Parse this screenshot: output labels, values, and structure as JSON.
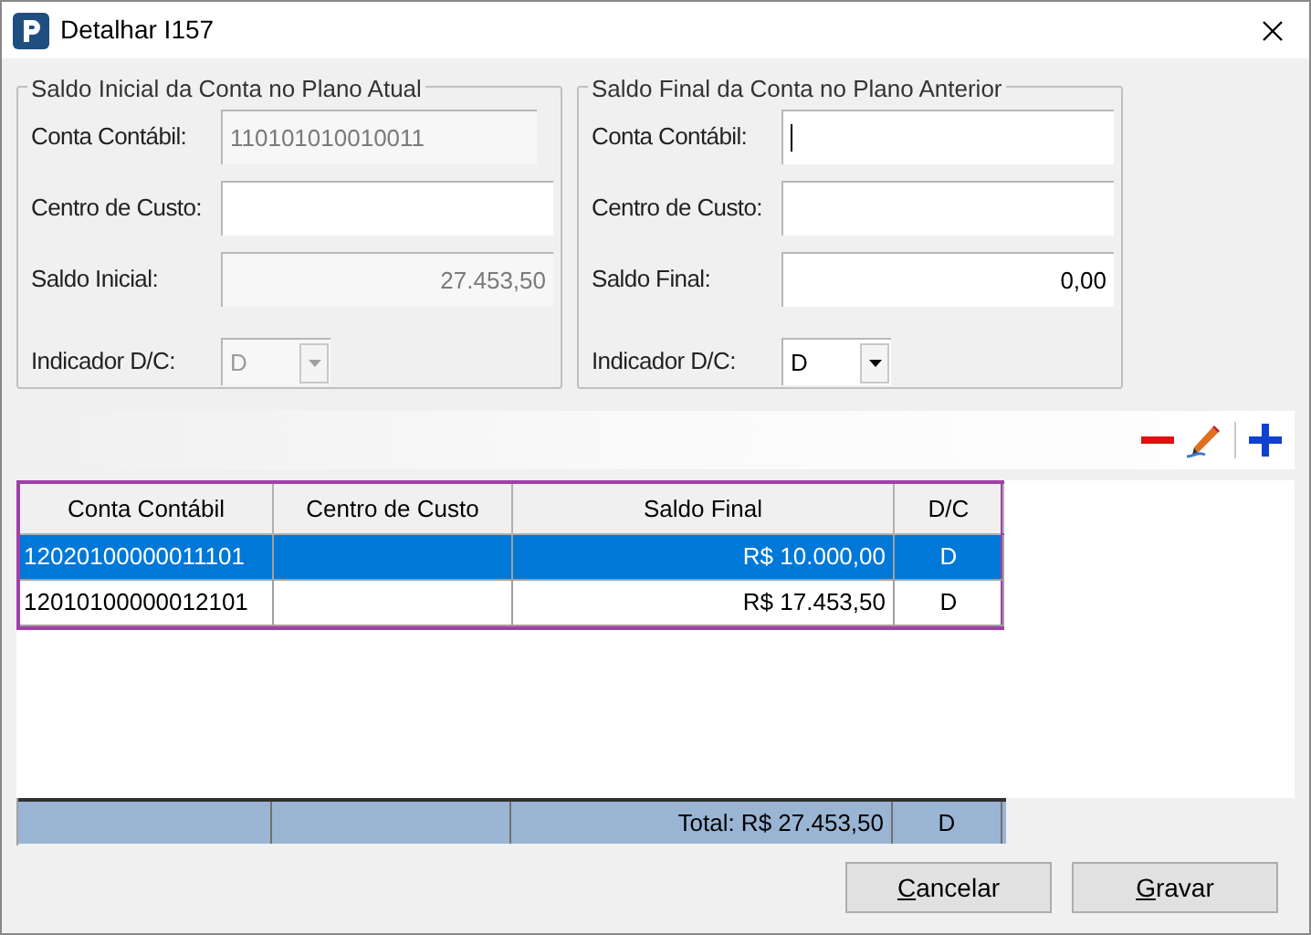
{
  "window": {
    "title": "Detalhar I157"
  },
  "groups": [
    {
      "title": "Saldo Inicial da Conta no Plano Atual",
      "fields": [
        {
          "kind": "text",
          "label": "Conta Contábil:",
          "value": "110101010010011",
          "readonly": true
        },
        {
          "kind": "text",
          "label": "Centro de Custo:"
        },
        {
          "kind": "number",
          "label": "Saldo Inicial:",
          "value": "27.453,50",
          "readonly": true
        },
        {
          "kind": "combo",
          "label": "Indicador D/C:",
          "value": "D",
          "readonly": true
        }
      ]
    },
    {
      "title": "Saldo Final da Conta no Plano Anterior",
      "fields": [
        {
          "kind": "text",
          "label": "Conta Contábil:",
          "focused": true
        },
        {
          "kind": "text",
          "label": "Centro de Custo:"
        },
        {
          "kind": "number",
          "label": "Saldo Final:",
          "value": "0,00"
        },
        {
          "kind": "combo",
          "label": "Indicador D/C:",
          "value": "D"
        }
      ]
    }
  ],
  "toolbar": [
    {
      "kind": "remove"
    },
    {
      "kind": "edit"
    },
    {
      "kind": "separator"
    },
    {
      "kind": "add"
    }
  ],
  "table": {
    "columns": [
      "Conta Contábil",
      "Centro de Custo",
      "Saldo Final",
      "D/C"
    ],
    "rows": [
      {
        "selected": true,
        "cells": [
          "12020100000011101",
          "",
          "R$ 10.000,00",
          "D"
        ]
      },
      {
        "selected": false,
        "cells": [
          "12010100000012101",
          "",
          "R$ 17.453,50",
          "D"
        ]
      }
    ],
    "footer": {
      "total": "Total: R$ 27.453,50",
      "dc": "D"
    }
  },
  "buttons": [
    {
      "label": "Cancelar",
      "underline_first": true
    },
    {
      "label": "Gravar",
      "underline_first": true
    }
  ]
}
